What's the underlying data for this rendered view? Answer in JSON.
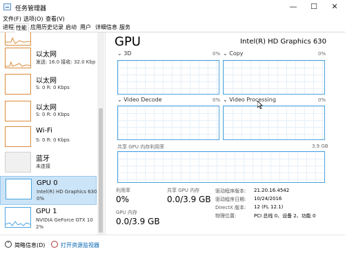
{
  "window": {
    "title": "任务管理器",
    "minimize": "—",
    "maximize": "☐",
    "close": "✕"
  },
  "menu": [
    "文件(F)",
    "选项(O)",
    "查看(V)"
  ],
  "tabs": [
    "进程",
    "性能",
    "应用历史记录",
    "启动",
    "用户",
    "详细信息",
    "服务"
  ],
  "active_tab": "性能",
  "sidebar": {
    "items": [
      {
        "name": "",
        "line1": "",
        "line2": "",
        "kind": "eth"
      },
      {
        "name": "以太网",
        "line1": "发送: 16.0 接收: 32.0 Kbp",
        "line2": "",
        "kind": "eth"
      },
      {
        "name": "以太网",
        "line1": "S: 0 R: 0 Kbps",
        "line2": "",
        "kind": "eth"
      },
      {
        "name": "以太网",
        "line1": "S: 0 R: 0 Kbps",
        "line2": "",
        "kind": "eth"
      },
      {
        "name": "Wi-Fi",
        "line1": "S: 0 R: 0 Kbps",
        "line2": "",
        "kind": "eth"
      },
      {
        "name": "蓝牙",
        "line1": "未连接",
        "line2": "",
        "kind": "bt"
      },
      {
        "name": "GPU 0",
        "line1": "Intel(R) HD Graphics 630",
        "line2": "0%",
        "kind": "gpu",
        "selected": true
      },
      {
        "name": "GPU 1",
        "line1": "NVIDIA GeForce GTX 10",
        "line2": "2%",
        "kind": "gpu"
      }
    ]
  },
  "main": {
    "title": "GPU",
    "model": "Intel(R) HD Graphics 630",
    "graphs": [
      {
        "label": "3D",
        "pct": "0%"
      },
      {
        "label": "Copy",
        "pct": "0%"
      },
      {
        "label": "Video Decode",
        "pct": "0%"
      },
      {
        "label": "Video Processing",
        "pct": "0%"
      }
    ],
    "shared_memory": {
      "label": "共享 GPU 内存利用率",
      "max": "3.9 GB"
    },
    "stats": {
      "utilization_label": "利用率",
      "utilization_value": "0%",
      "shared_mem_label": "共享 GPU 内存",
      "shared_mem_value": "0.0/3.9 GB",
      "gpu_mem_label": "GPU 内存",
      "gpu_mem_value": "0.0/3.9 GB"
    },
    "info": [
      {
        "label": "驱动程序版本:",
        "value": "21.20.16.4542"
      },
      {
        "label": "驱动程序日期:",
        "value": "10/24/2016"
      },
      {
        "label": "DirectX 版本:",
        "value": "12 (FL 12.1)"
      },
      {
        "label": "物理位置:",
        "value": "PCI 总线 0、设备 2、功能 0"
      }
    ]
  },
  "footer": {
    "fewer_details": "简略信息(D)",
    "open_monitor": "打开资源监视器"
  },
  "colors": {
    "network": "#d98b3a",
    "gpu": "#4aa3df",
    "selected_bg": "#cce4f7",
    "link": "#0063b1"
  }
}
